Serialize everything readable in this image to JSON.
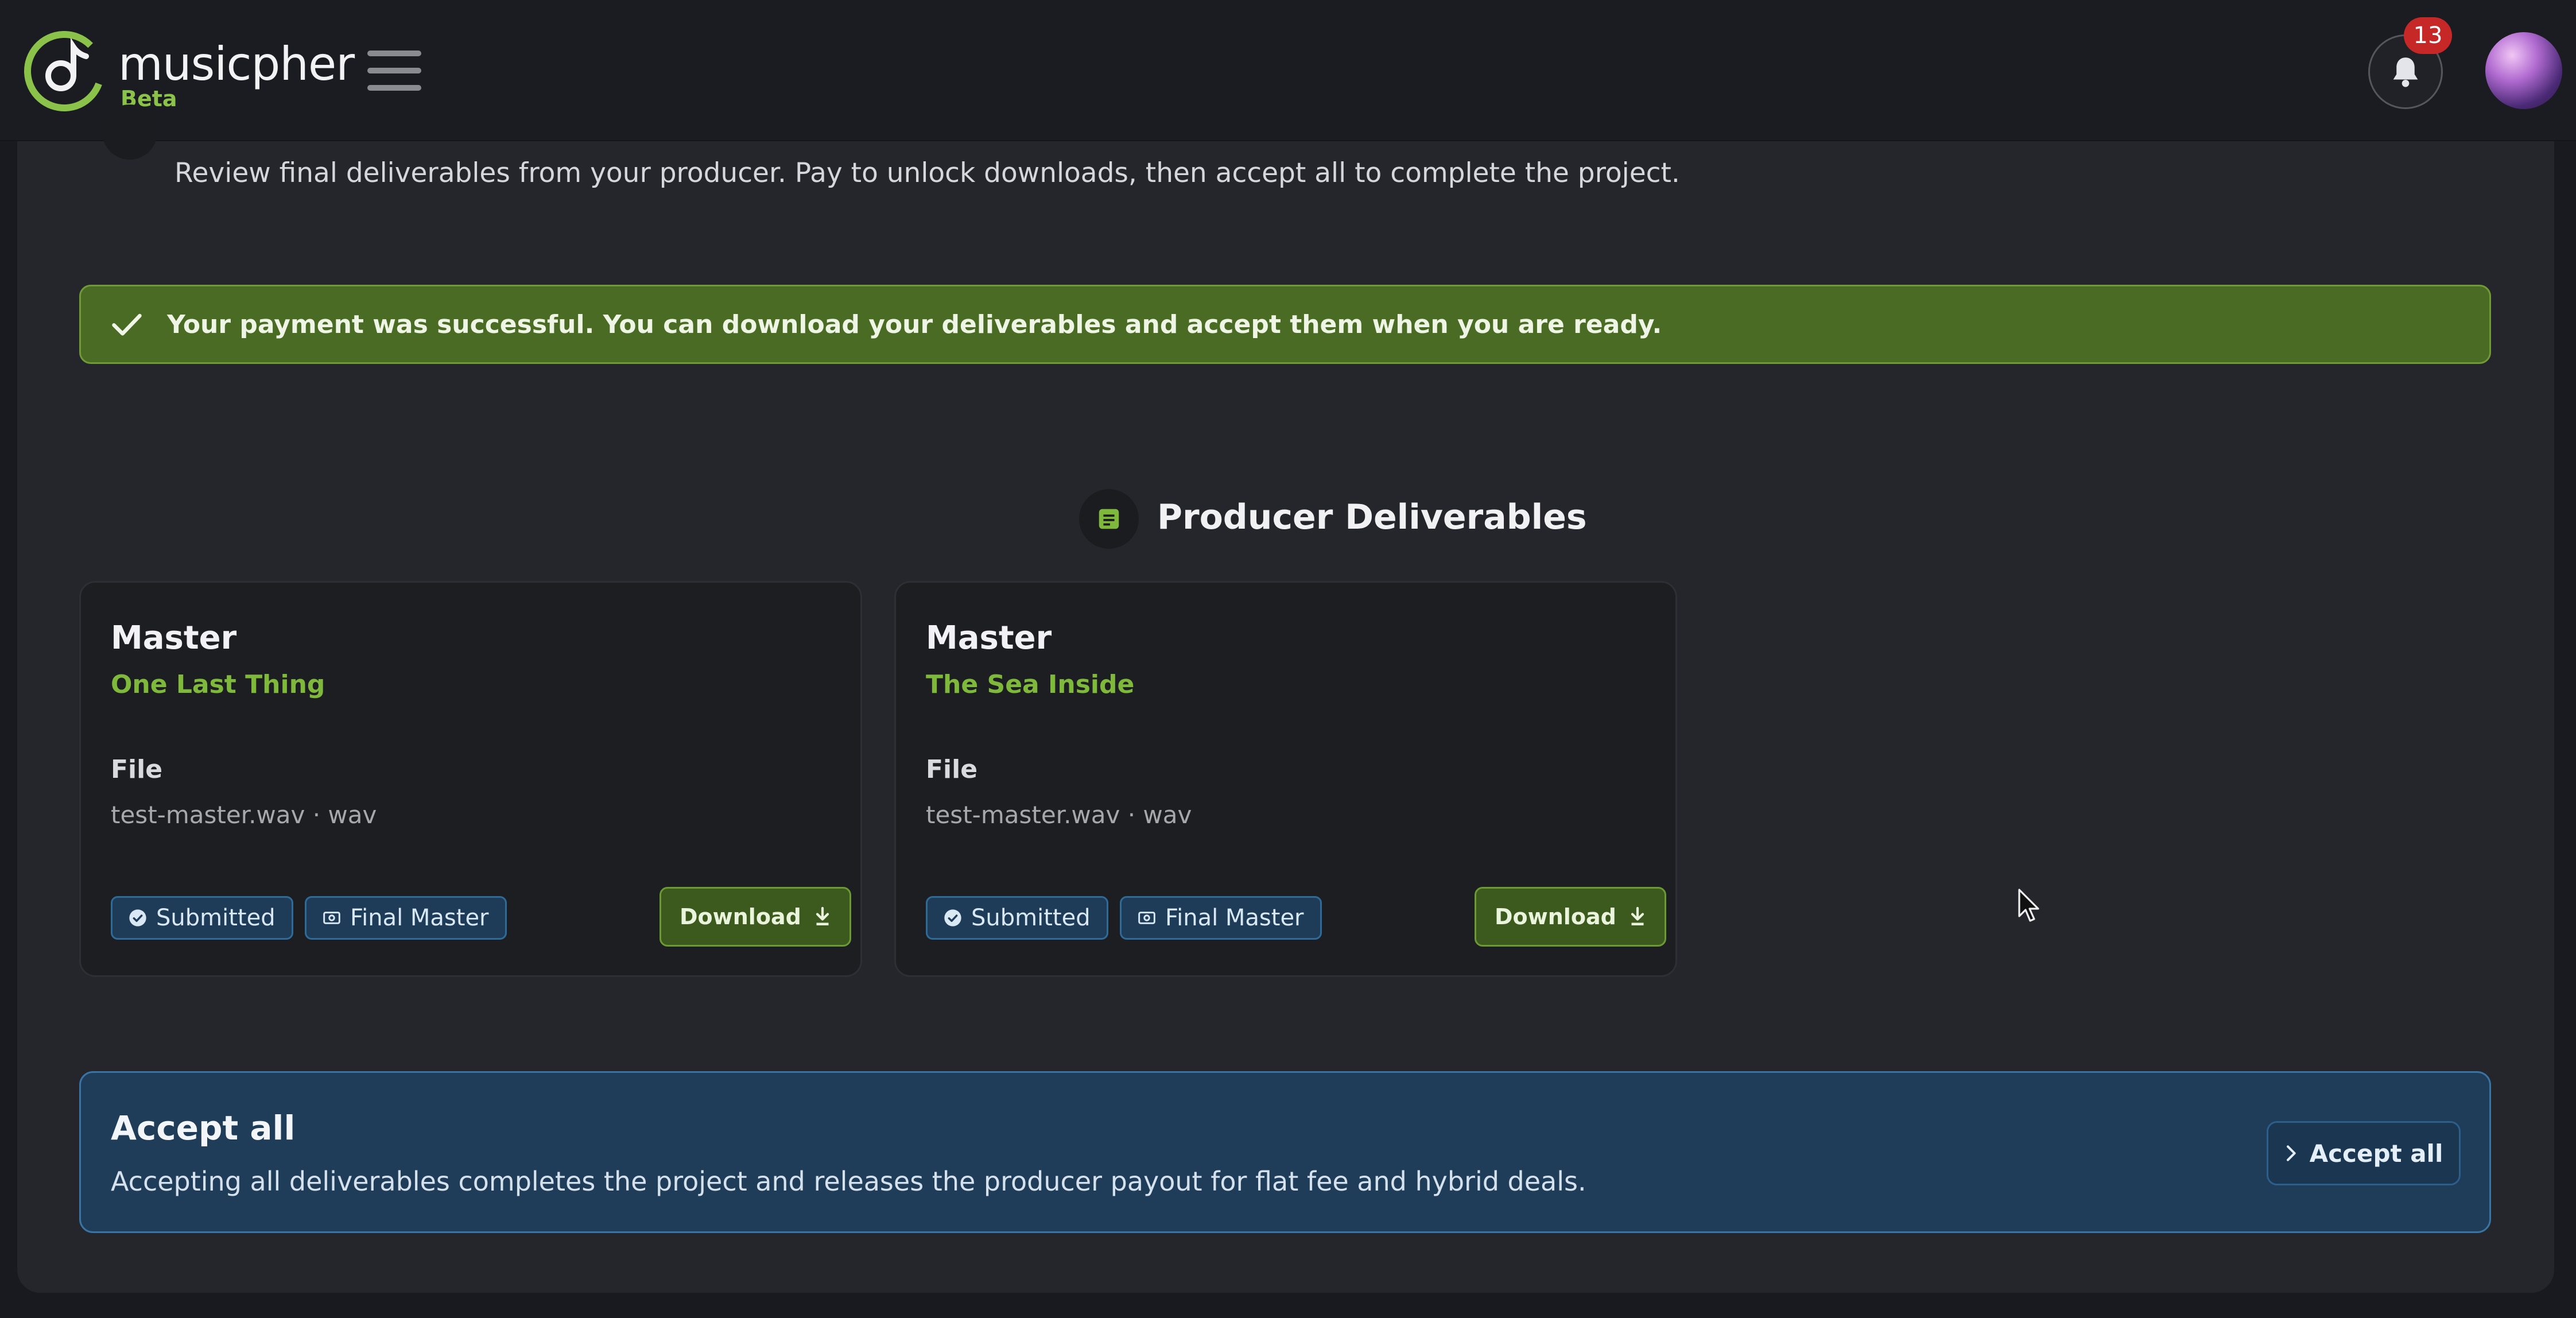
{
  "header": {
    "logo_text": "musicpher",
    "beta_label": "Beta",
    "notification_count": "13"
  },
  "page": {
    "intro": "Review final deliverables from your producer. Pay to unlock downloads, then accept all to complete the project.",
    "success_message": "Your payment was successful. You can download your deliverables and accept them when you are ready.",
    "section_title": "Producer Deliverables"
  },
  "deliverables": [
    {
      "type": "Master",
      "track": "One Last Thing",
      "file_label": "File",
      "file_name": "test-master.wav · wav",
      "status_tag": "Submitted",
      "kind_tag": "Final Master",
      "download_label": "Download"
    },
    {
      "type": "Master",
      "track": "The Sea Inside",
      "file_label": "File",
      "file_name": "test-master.wav · wav",
      "status_tag": "Submitted",
      "kind_tag": "Final Master",
      "download_label": "Download"
    }
  ],
  "accept_all": {
    "title": "Accept all",
    "description": "Accepting all deliverables completes the project and releases the producer payout for flat fee and hybrid deals.",
    "button_label": "Accept all"
  },
  "colors": {
    "accent_green": "#8bc34a",
    "success_bg": "#4a6b24",
    "info_bg": "#1f3d59",
    "badge_red": "#c62828"
  },
  "icons": [
    "logo-icon",
    "hamburger-menu-icon",
    "bell-icon",
    "check-icon",
    "document-icon",
    "check-circle-icon",
    "tag-icon",
    "download-icon",
    "chevron-right-icon"
  ]
}
